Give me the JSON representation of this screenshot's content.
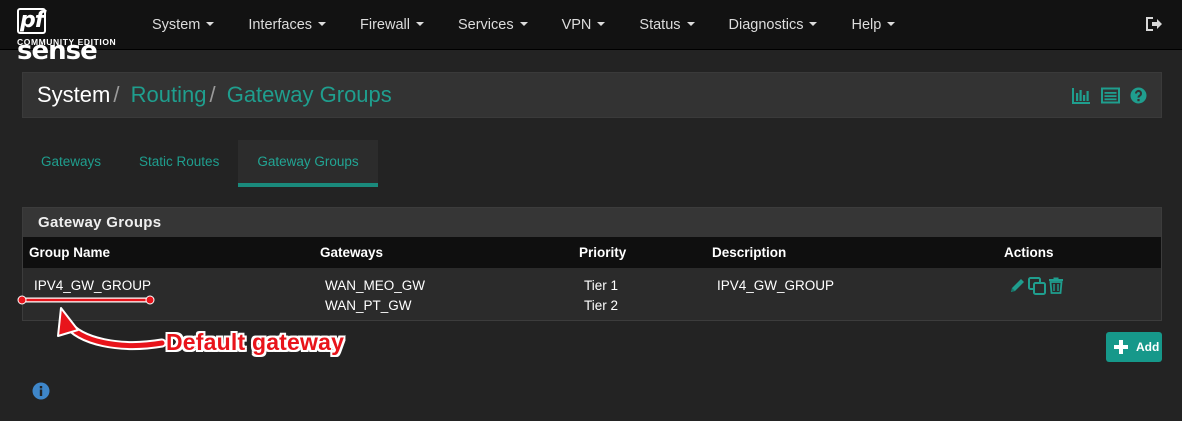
{
  "logo": {
    "main_pf": "pf",
    "main_rest": "sense",
    "sub": "COMMUNITY EDITION"
  },
  "nav": {
    "items": [
      {
        "label": "System"
      },
      {
        "label": "Interfaces"
      },
      {
        "label": "Firewall"
      },
      {
        "label": "Services"
      },
      {
        "label": "VPN"
      },
      {
        "label": "Status"
      },
      {
        "label": "Diagnostics"
      },
      {
        "label": "Help"
      }
    ],
    "logout_icon": "logout-icon"
  },
  "breadcrumb": {
    "root": "System",
    "sep": "/",
    "level1": "Routing",
    "level2": "Gateway Groups",
    "icons": [
      "bar-chart-icon",
      "list-icon",
      "help-icon"
    ],
    "accent": "#1f9e8e"
  },
  "tabs": [
    {
      "label": "Gateways",
      "active": false
    },
    {
      "label": "Static Routes",
      "active": false
    },
    {
      "label": "Gateway Groups",
      "active": true
    }
  ],
  "panel": {
    "title": "Gateway Groups",
    "columns": [
      "Group Name",
      "Gateways",
      "Priority",
      "Description",
      "Actions"
    ],
    "rows": [
      {
        "group_name": "IPV4_GW_GROUP",
        "gateways": [
          "WAN_MEO_GW",
          "WAN_PT_GW"
        ],
        "priorities": [
          "Tier 1",
          "Tier 2"
        ],
        "description": "IPV4_GW_GROUP",
        "actions": [
          "edit-icon",
          "copy-icon",
          "delete-icon"
        ]
      }
    ]
  },
  "add_button": {
    "label": "Add",
    "icon": "plus-icon"
  },
  "info_icon": "info-icon",
  "annotation": {
    "text": "Default gateway",
    "color": "#e8141b"
  }
}
